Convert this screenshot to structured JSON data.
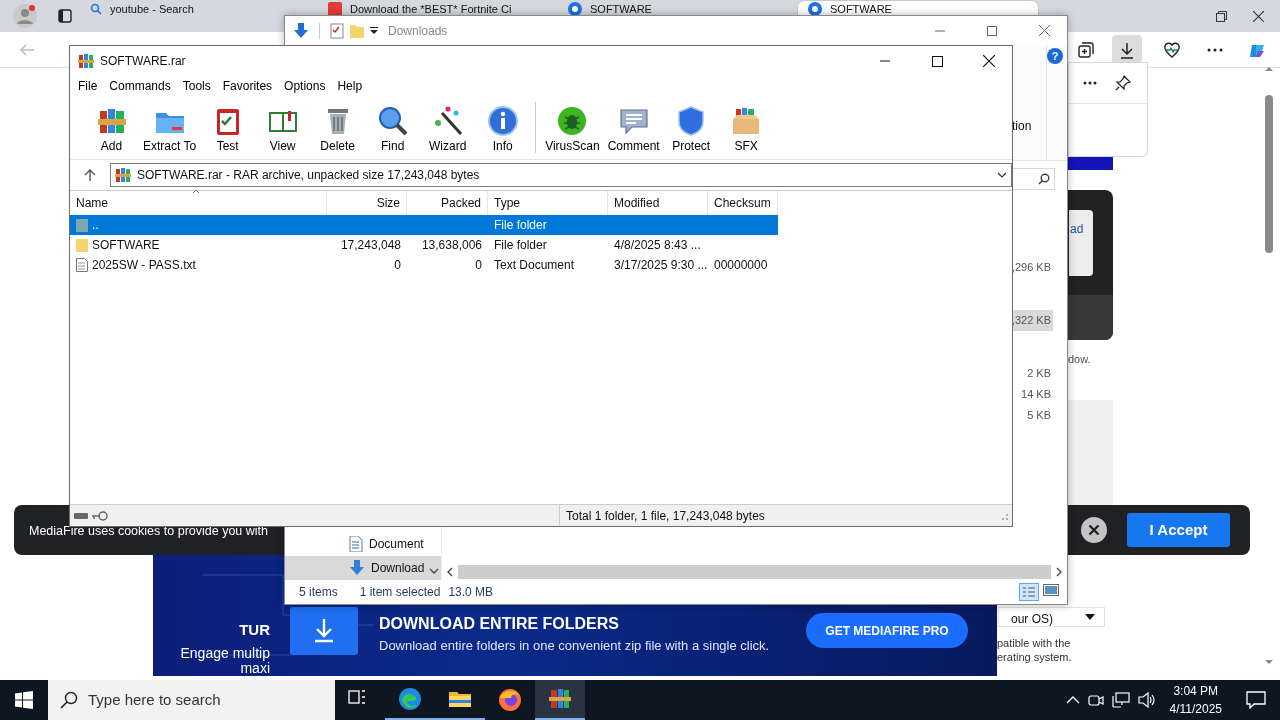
{
  "browser": {
    "tabs": [
      {
        "title": "youtube - Search",
        "selected": false
      },
      {
        "title": "Download the *BEST* Fortnite Ci",
        "selected": false
      },
      {
        "title": "SOFTWARE",
        "selected": false
      },
      {
        "title": "SOFTWARE",
        "selected": true
      }
    ],
    "page": {
      "button_fragment": "ad",
      "note_fragment": "dow.",
      "select_fragment": "our OS)",
      "compat_lines": [
        "patible with the",
        "erating system."
      ]
    },
    "cookie_banner": {
      "text": "MediaFire uses cookies to provide you with",
      "accept": "I Accept"
    },
    "ad": {
      "left_title": "TUR",
      "left_lines": [
        "Engage multip",
        "maxi"
      ],
      "title": "DOWNLOAD ENTIRE FOLDERS",
      "text": "Download entire folders in one convenient zip file with a single click.",
      "button": "GET MEDIAFIRE PRO"
    }
  },
  "downloads_window": {
    "title": "Downloads",
    "help": "?",
    "ribbon_fragment": "tion",
    "sizes": [
      {
        "text": ",296 KB",
        "selected": false
      },
      {
        "text": ",322 KB",
        "selected": true
      },
      {
        "text": "2 KB",
        "selected": false
      },
      {
        "text": "14 KB",
        "selected": false
      },
      {
        "text": "5 KB",
        "selected": false
      }
    ],
    "nav_items": [
      {
        "label": "Document",
        "kind": "document",
        "selected": false
      },
      {
        "label": "Download",
        "kind": "download",
        "selected": true
      }
    ],
    "status": {
      "count": "5 items",
      "selection": "1 item selected",
      "size": "13.0 MB"
    }
  },
  "winrar": {
    "title": "SOFTWARE.rar",
    "menu": [
      "File",
      "Commands",
      "Tools",
      "Favorites",
      "Options",
      "Help"
    ],
    "toolbar_groups": [
      [
        "Add",
        "Extract To",
        "Test",
        "View",
        "Delete",
        "Find",
        "Wizard",
        "Info"
      ],
      [
        "VirusScan",
        "Comment",
        "Protect",
        "SFX"
      ]
    ],
    "address": "SOFTWARE.rar - RAR archive, unpacked size 17,243,048 bytes",
    "columns": [
      "Name",
      "Size",
      "Packed",
      "Type",
      "Modified",
      "Checksum"
    ],
    "rows": [
      {
        "kind": "up",
        "name": "..",
        "size": "",
        "packed": "",
        "type": "File folder",
        "modified": "",
        "checksum": "",
        "selected": true
      },
      {
        "kind": "folder",
        "name": "SOFTWARE",
        "size": "17,243,048",
        "packed": "13,638,006",
        "type": "File folder",
        "modified": "4/8/2025 8:43 ...",
        "checksum": "",
        "selected": false
      },
      {
        "kind": "file",
        "name": "2025SW - PASS.txt",
        "size": "0",
        "packed": "0",
        "type": "Text Document",
        "modified": "3/17/2025 9:30 ...",
        "checksum": "00000000",
        "selected": false
      }
    ],
    "status": "Total 1 folder, 1 file, 17,243,048 bytes"
  },
  "taskbar": {
    "search_placeholder": "Type here to search",
    "apps": [
      {
        "kind": "taskview",
        "running": false,
        "selected": false
      },
      {
        "kind": "edge",
        "running": true,
        "selected": false
      },
      {
        "kind": "explorer",
        "running": true,
        "selected": false
      },
      {
        "kind": "firefox",
        "running": false,
        "selected": false
      },
      {
        "kind": "winrar",
        "running": true,
        "selected": true
      }
    ],
    "time": "3:04 PM",
    "date": "4/11/2025"
  }
}
